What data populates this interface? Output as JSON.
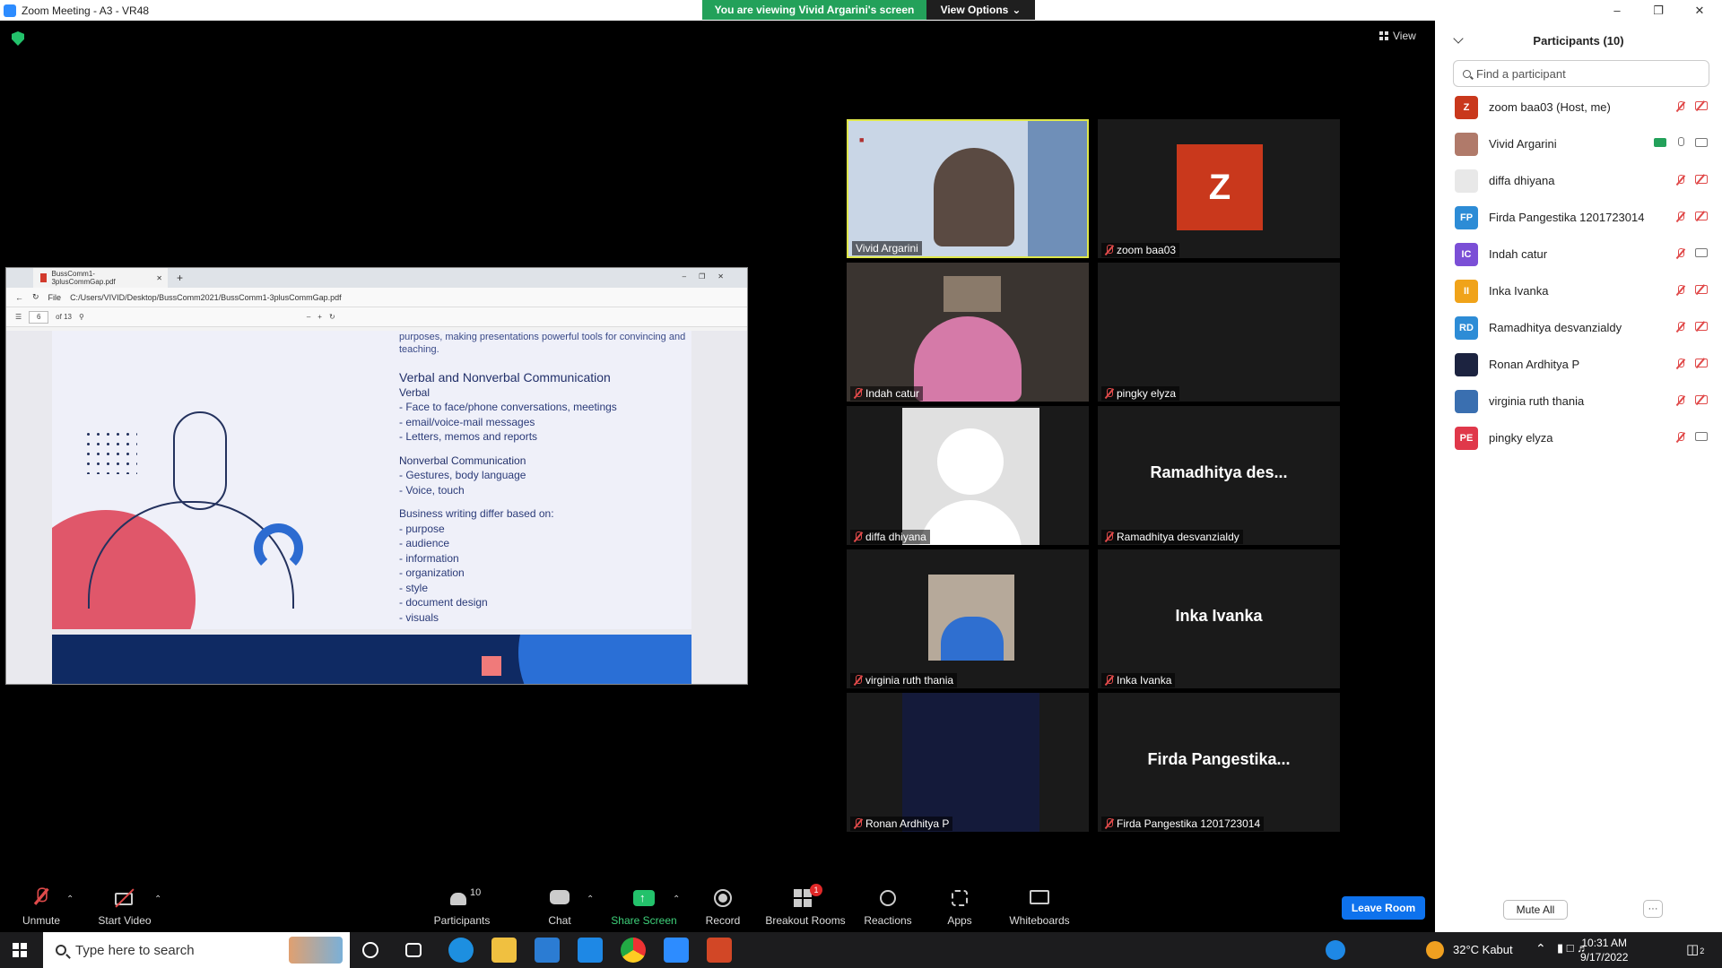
{
  "window": {
    "title": "Zoom Meeting - A3 - VR48"
  },
  "banner": {
    "viewing": "You are viewing Vivid Argarini's screen",
    "view_options": "View Options"
  },
  "view_button": "View",
  "shared": {
    "tab_title": "BussComm1-3plusCommGap.pdf",
    "address_prefix": "File",
    "address": "C:/Users/VIVID/Desktop/BussComm2021/BussComm1-3plusCommGap.pdf",
    "page_num": "6",
    "page_of": "of 13",
    "pdf": {
      "intro": "purposes, making presentations powerful tools for convincing and teaching.",
      "heading": "Verbal and Nonverbal Communication",
      "verbal_title": "Verbal",
      "verbal_items": [
        "- Face to face/phone conversations, meetings",
        "- email/voice-mail messages",
        "- Letters, memos and reports"
      ],
      "nonverbal_title": "Nonverbal Communication",
      "nonverbal_items": [
        "- Gestures, body language",
        "- Voice, touch"
      ],
      "writing_title": "Business writing differ based on:",
      "writing_items": [
        "- purpose",
        "- audience",
        "- information",
        "- organization",
        "- style",
        "- document design",
        "- visuals"
      ]
    }
  },
  "tiles": [
    {
      "name": "Vivid Argarini",
      "muted": false
    },
    {
      "name": "zoom baa03",
      "avatar_letter": "Z",
      "muted": true
    },
    {
      "name": "Indah catur",
      "muted": true
    },
    {
      "name": "pingky elyza",
      "muted": true
    },
    {
      "name": "diffa dhiyana",
      "muted": true
    },
    {
      "name": "Ramadhitya desvanzialdy",
      "big": "Ramadhitya des...",
      "muted": true
    },
    {
      "name": "virginia ruth thania",
      "muted": true
    },
    {
      "name": "Inka Ivanka",
      "big": "Inka Ivanka",
      "muted": true
    },
    {
      "name": "Ronan Ardhitya P",
      "muted": true
    },
    {
      "name": "Firda Pangestika 1201723014",
      "big": "Firda Pangestika...",
      "muted": true
    }
  ],
  "panel": {
    "title": "Participants (10)",
    "search_placeholder": "Find a participant",
    "participants": [
      {
        "name": "zoom baa03 (Host, me)",
        "initials": "Z",
        "color": "#c9381c",
        "video": "off"
      },
      {
        "name": "Vivid Argarini",
        "initials": "",
        "color": "#b07a6a",
        "video": "on",
        "sharing": true,
        "mic": "on"
      },
      {
        "name": "diffa dhiyana",
        "initials": "",
        "color": "#e8e8e8",
        "video": "off"
      },
      {
        "name": "Firda Pangestika 1201723014",
        "initials": "FP",
        "color": "#2d8cd6",
        "video": "off"
      },
      {
        "name": "Indah catur",
        "initials": "IC",
        "color": "#7b4fd6",
        "video": "on"
      },
      {
        "name": "Inka Ivanka",
        "initials": "II",
        "color": "#f0a31a",
        "video": "off"
      },
      {
        "name": "Ramadhitya desvanzialdy",
        "initials": "RD",
        "color": "#2d8cd6",
        "video": "off"
      },
      {
        "name": "Ronan Ardhitya P",
        "initials": "",
        "color": "#1c2340",
        "video": "off"
      },
      {
        "name": "virginia ruth thania",
        "initials": "",
        "color": "#3a6fb0",
        "video": "off"
      },
      {
        "name": "pingky elyza",
        "initials": "PE",
        "color": "#e0384a",
        "video": "on"
      }
    ],
    "mute_all": "Mute All",
    "more": "···"
  },
  "toolbar": {
    "unmute": "Unmute",
    "start_video": "Start Video",
    "participants": "Participants",
    "participants_count": "10",
    "chat": "Chat",
    "share_screen": "Share Screen",
    "record": "Record",
    "breakout_rooms": "Breakout Rooms",
    "breakout_badge": "1",
    "reactions": "Reactions",
    "apps": "Apps",
    "whiteboards": "Whiteboards",
    "leave": "Leave Room"
  },
  "taskbar": {
    "search_placeholder": "Type here to search",
    "weather": "32°C  Kabut",
    "time": "10:31 AM",
    "date": "9/17/2022",
    "notif_badge": "2"
  }
}
